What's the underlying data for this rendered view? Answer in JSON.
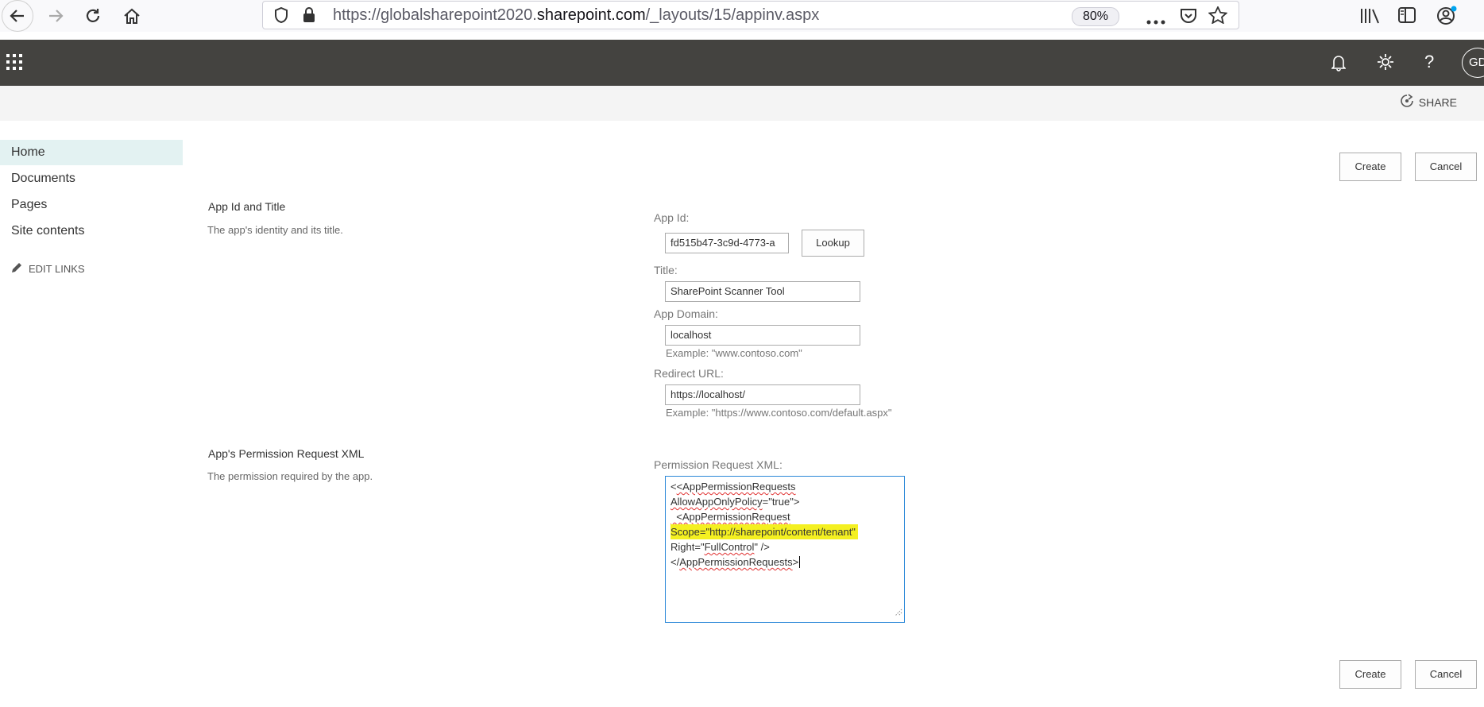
{
  "browser": {
    "url_prefix": "https://globalsharepoint2020.",
    "url_domain": "sharepoint.com",
    "url_path": "/_layouts/15/appinv.aspx",
    "zoom": "80%"
  },
  "suite": {
    "avatar_initials": "GD"
  },
  "command_bar": {
    "share_label": "SHARE"
  },
  "left_nav": {
    "items": [
      "Home",
      "Documents",
      "Pages",
      "Site contents"
    ],
    "edit_links": "EDIT LINKS"
  },
  "buttons": {
    "create": "Create",
    "cancel": "Cancel",
    "lookup": "Lookup"
  },
  "section_app": {
    "title": "App Id and Title",
    "description": "The app's identity and its title.",
    "app_id_label": "App Id:",
    "app_id_value": "fd515b47-3c9d-4773-a",
    "title_label": "Title:",
    "title_value": "SharePoint Scanner Tool",
    "domain_label": "App Domain:",
    "domain_value": "localhost",
    "domain_example": "Example: \"www.contoso.com\"",
    "redirect_label": "Redirect URL:",
    "redirect_value": "https://localhost/",
    "redirect_example": "Example: \"https://www.contoso.com/default.aspx\""
  },
  "section_permission": {
    "title": "App's Permission Request XML",
    "description": "The permission required by the app.",
    "xml_label": "Permission Request XML:",
    "xml_lines": {
      "l1": "<AppPermissionRequests",
      "l2_a": "AllowAppOnlyPolicy",
      "l2_b": "=\"true\">",
      "l3": "  <AppPermissionRequest",
      "l4": "Scope=\"http://sharepoint/content/tenant\"",
      "l5_a": "Right=\"",
      "l5_b": "FullControl",
      "l5_c": "\" />",
      "l6_a": "</",
      "l6_b": "AppPermissionRequests",
      "l6_c": ">"
    }
  },
  "colors": {
    "suite_bar": "#444340",
    "accent": "#2b88d8",
    "highlight": "#f4f021",
    "selected_nav": "#e3f2f2"
  }
}
